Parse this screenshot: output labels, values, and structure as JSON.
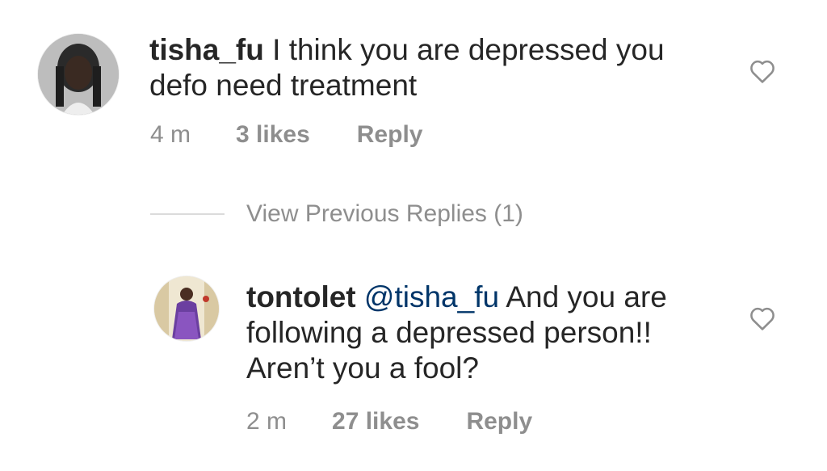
{
  "comments": [
    {
      "username": "tisha_fu",
      "text": "I think you are depressed you defo need treatment",
      "time": "4 m",
      "likes": "3 likes",
      "reply_label": "Reply",
      "liked": false
    },
    {
      "username": "tontolet",
      "mention": "@tisha_fu",
      "text": "And you are following a depressed person!! Aren’t you a fool?",
      "time": "2 m",
      "likes": "27 likes",
      "reply_label": "Reply",
      "liked": false
    }
  ],
  "view_previous_replies": "View Previous Replies (1)",
  "colors": {
    "text": "#262626",
    "meta": "#8e8e8e",
    "mention": "#003569",
    "divider": "#dbdbdb"
  }
}
